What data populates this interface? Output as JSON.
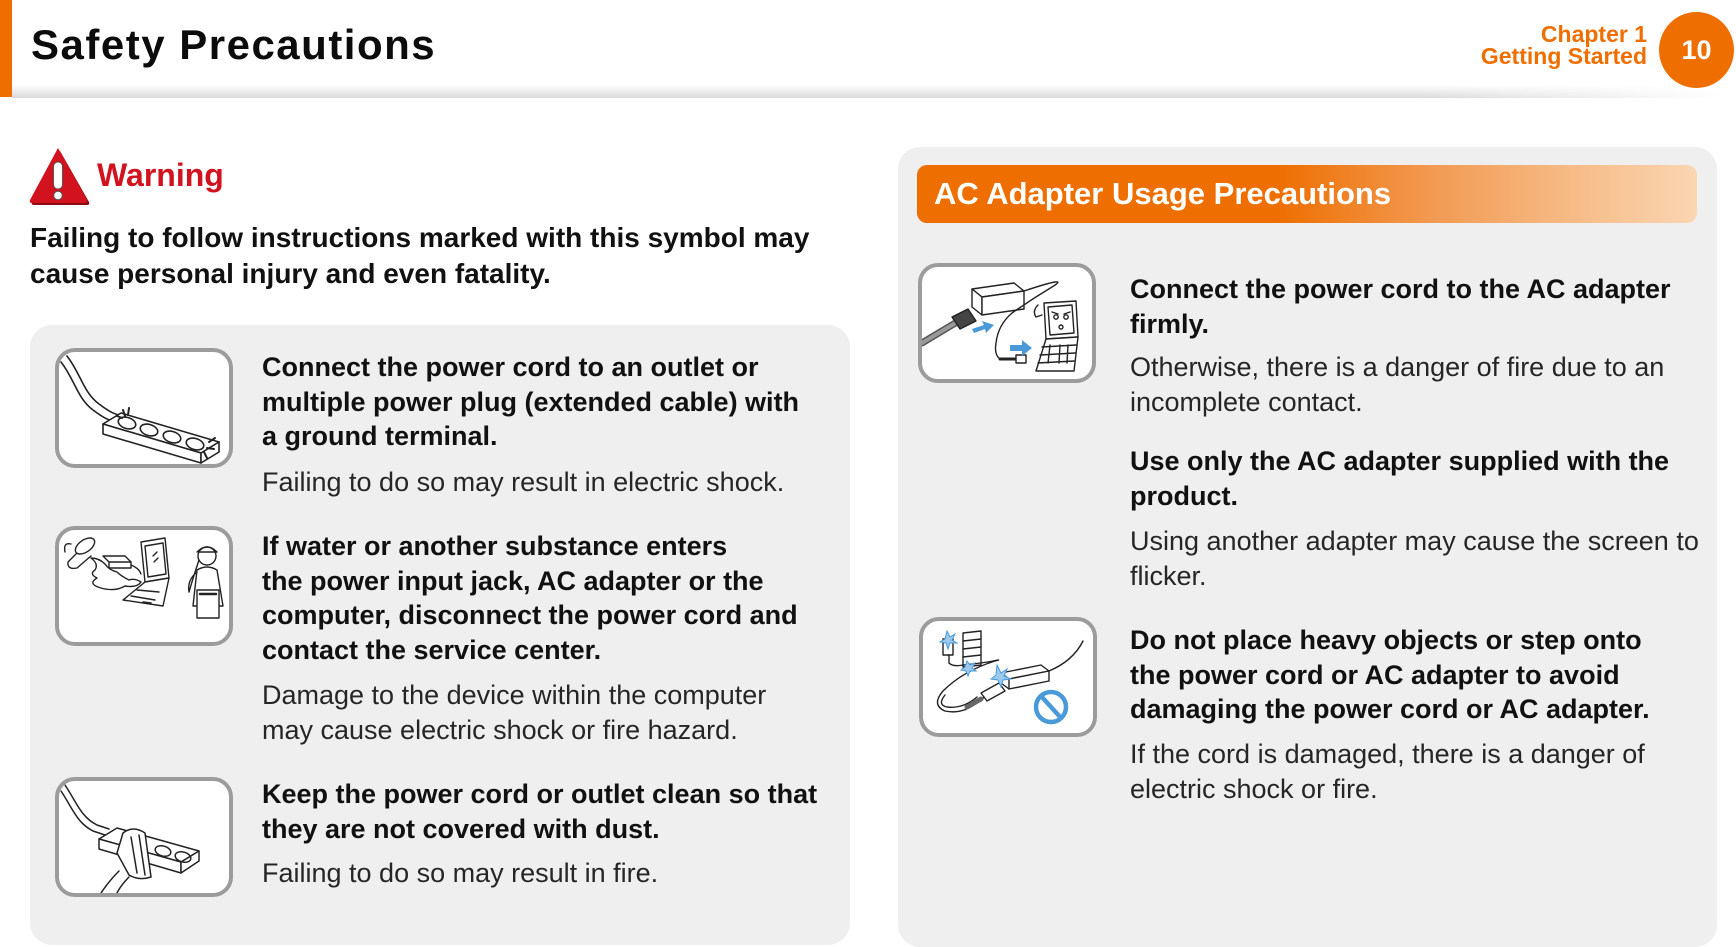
{
  "colors": {
    "accent": "#ee6e00",
    "warning_red": "#d2121e",
    "panel_bg": "#eeefee",
    "illustration_blue": "#4a9ad9"
  },
  "header": {
    "title": "Safety Precautions",
    "chapter_label": "Chapter 1",
    "chapter_title": "Getting Started",
    "page_number": "10"
  },
  "warning": {
    "icon": "warning-triangle-icon",
    "label": "Warning",
    "intro_lines": [
      "Failing to follow instructions marked with this symbol may",
      "cause personal injury and even fatality."
    ]
  },
  "left_items": [
    {
      "illustration": "power-strip-ground-illustration",
      "heading_lines": [
        "Connect the power cord to an outlet or",
        "multiple power plug (extended cable) with",
        "a ground terminal."
      ],
      "body_lines": [
        "Failing to do so may result in electric shock."
      ]
    },
    {
      "illustration": "liquid-spill-service-center-illustration",
      "heading_lines": [
        "If water or another substance enters",
        "the power input jack, AC adapter or the",
        "computer, disconnect the power cord and",
        "contact the service center."
      ],
      "body_lines": [
        "Damage to the device within the computer",
        "may cause electric shock or fire hazard."
      ]
    },
    {
      "illustration": "clean-power-strip-illustration",
      "heading_lines": [
        "Keep the power cord or outlet clean so that",
        "they are not covered with dust."
      ],
      "body_lines": [
        "Failing to do so may result in fire."
      ]
    }
  ],
  "ac_section": {
    "title": "AC Adapter Usage Precautions",
    "items": [
      {
        "illustration": "adapter-connection-illustration",
        "heading_lines": [
          "Connect the power cord to the AC adapter",
          "firmly."
        ],
        "body_lines": [
          "Otherwise, there is a danger of fire due to an",
          "incomplete contact."
        ]
      },
      {
        "illustration": null,
        "heading_lines": [
          "Use only the AC adapter supplied with the",
          "product."
        ],
        "body_lines": [
          "Using another adapter may cause the screen to",
          "flicker."
        ]
      },
      {
        "illustration": "no-heavy-objects-on-cord-illustration",
        "heading_lines": [
          "Do not place heavy objects or step onto",
          "the power cord or AC adapter to avoid",
          "damaging the power cord or AC adapter."
        ],
        "body_lines": [
          "If the cord is damaged, there is a danger of",
          "electric shock or fire."
        ]
      }
    ]
  }
}
